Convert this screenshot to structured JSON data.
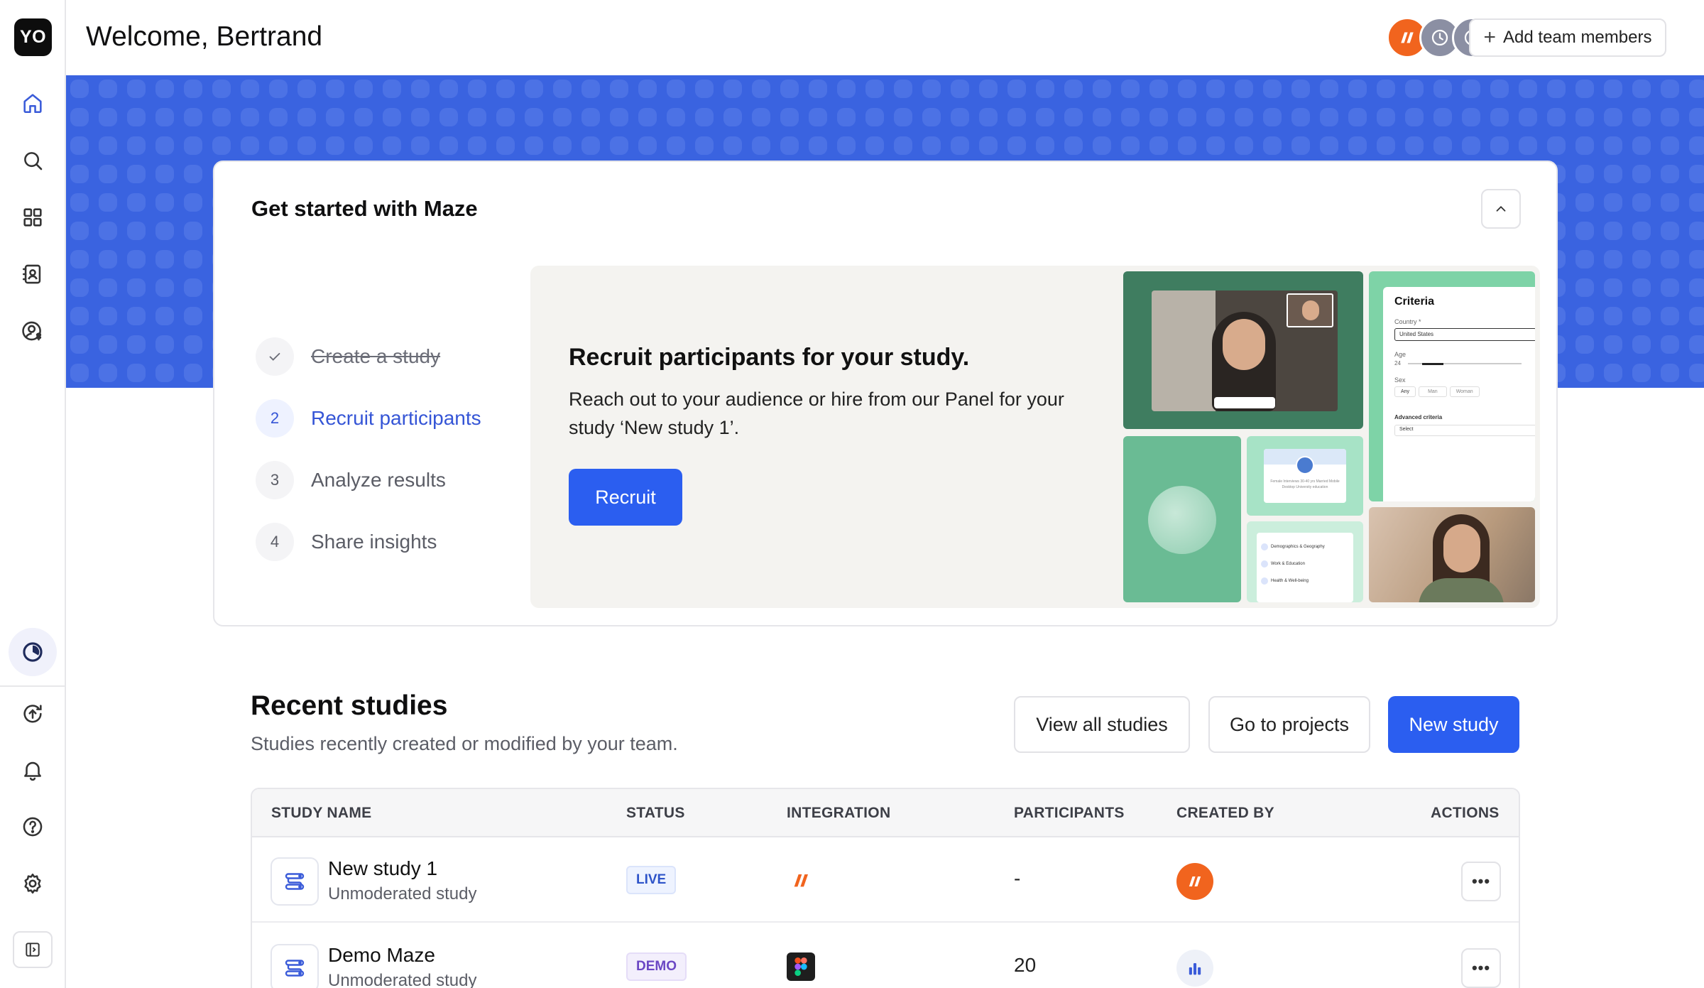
{
  "sidebar": {
    "logo_text": "YO",
    "nav": [
      {
        "name": "home-icon"
      },
      {
        "name": "search-icon"
      },
      {
        "name": "grid-icon"
      },
      {
        "name": "contacts-icon"
      },
      {
        "name": "participant-panel-icon"
      }
    ],
    "bottom_nav": [
      {
        "name": "usage-icon",
        "active": true
      },
      {
        "name": "upgrade-icon"
      },
      {
        "name": "bell-icon"
      },
      {
        "name": "help-icon"
      },
      {
        "name": "settings-icon"
      },
      {
        "name": "collapse-sidebar-icon"
      }
    ]
  },
  "header": {
    "welcome": "Welcome, Bertrand",
    "add_team_label": "Add team members",
    "team_avatars": [
      "maze-avatar",
      "pending-invite",
      "pending-invite",
      "pending-invite"
    ]
  },
  "get_started": {
    "title": "Get started with Maze",
    "steps": [
      {
        "num": "",
        "label": "Create a study",
        "state": "done"
      },
      {
        "num": "2",
        "label": "Recruit participants",
        "state": "current"
      },
      {
        "num": "3",
        "label": "Analyze results",
        "state": "todo"
      },
      {
        "num": "4",
        "label": "Share insights",
        "state": "todo"
      }
    ],
    "promo": {
      "title": "Recruit participants for your study.",
      "text": "Reach out to your audience or hire from our Panel for your study ‘New study 1’.",
      "button": "Recruit"
    },
    "collage": {
      "criteria_title": "Criteria",
      "country_label": "Country *",
      "country_value": "United States",
      "age_label": "Age",
      "age_value": "24",
      "sex_label": "Sex",
      "sex_options": [
        "Any",
        "Man",
        "Woman"
      ],
      "advanced_label": "Advanced criteria",
      "advanced_value": "Select",
      "filters": [
        "Demographics & Geography",
        "Work & Education",
        "Health & Well-being"
      ],
      "profile_tags": [
        "Female",
        "Interviews",
        "30-40 yrs",
        "Married",
        "Mobile",
        "Desktop",
        "University education"
      ]
    }
  },
  "recent": {
    "title": "Recent studies",
    "subtitle": "Studies recently created or modified by your team.",
    "view_all": "View all studies",
    "go_projects": "Go to projects",
    "new_study": "New study",
    "columns": [
      "STUDY NAME",
      "STATUS",
      "INTEGRATION",
      "PARTICIPANTS",
      "CREATED BY",
      "ACTIONS"
    ],
    "rows": [
      {
        "name": "New study 1",
        "type": "Unmoderated study",
        "status": "LIVE",
        "integration": "maze-icon",
        "participants": "-",
        "creator": "maze-avatar",
        "actions": "•••"
      },
      {
        "name": "Demo Maze",
        "type": "Unmoderated study",
        "status": "DEMO",
        "integration": "figma-icon",
        "participants": "20",
        "creator": "team-avatar",
        "actions": "•••"
      }
    ]
  },
  "colors": {
    "accent": "#2b5ef0",
    "banner": "#3a63e0",
    "maze_orange": "#f1641e",
    "step_current": "#3555d6"
  }
}
